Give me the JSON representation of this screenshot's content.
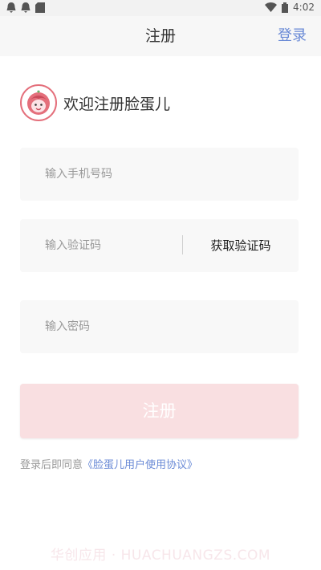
{
  "status_bar": {
    "time": "4:02",
    "left_icons": [
      "notification-icon",
      "notification-icon",
      "sdcard-icon"
    ],
    "right_icons": [
      "wifi-icon",
      "battery-icon"
    ]
  },
  "header": {
    "title": "注册",
    "login_label": "登录"
  },
  "welcome": {
    "logo": "lianDanEr-logo",
    "text": "欢迎注册脸蛋儿"
  },
  "form": {
    "phone_placeholder": "输入手机号码",
    "code_placeholder": "输入验证码",
    "get_code_label": "获取验证码",
    "password_placeholder": "输入密码",
    "submit_label": "注册"
  },
  "agreement": {
    "prefix": "登录后即同意",
    "link": "《脸蛋儿用户使用协议》"
  },
  "watermark": "华创应用 · HUACHUANGZS.COM",
  "colors": {
    "accent_blue": "#6a8ad6",
    "submit_disabled": "#f9dfe1",
    "logo_red": "#e46f7b"
  }
}
